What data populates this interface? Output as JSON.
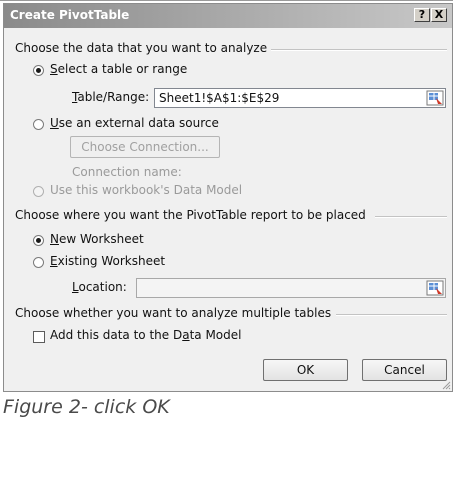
{
  "dialog": {
    "title": "Create PivotTable",
    "help_label": "?",
    "close_label": "X",
    "section_data": "Choose the data that you want to analyze",
    "select_range_label": "Select a table or range",
    "table_range_label": "Table/Range:",
    "table_range_value": "Sheet1!$A$1:$E$29",
    "external_source_label": "Use an external data source",
    "choose_connection_label": "Choose Connection...",
    "connection_name_label": "Connection name:",
    "data_model_label": "Use this workbook's Data Model",
    "section_placement": "Choose where you want the PivotTable report to be placed",
    "new_worksheet_label": "New Worksheet",
    "existing_worksheet_label": "Existing Worksheet",
    "location_label": "Location:",
    "location_value": "",
    "section_multiple": "Choose whether you want to analyze multiple tables",
    "add_data_model_label": "Add this data to the Data Model",
    "ok_label": "OK",
    "cancel_label": "Cancel",
    "selected_source": "select-range",
    "selected_placement": "new-worksheet",
    "add_to_data_model": false
  },
  "caption": "Figure 2- click OK",
  "colors": {
    "title_gradient_start": "#8a8a8a",
    "title_gradient_end": "#c8c8c8",
    "dialog_bg": "#f0f0f0",
    "caption_text": "#4a4a4a"
  }
}
